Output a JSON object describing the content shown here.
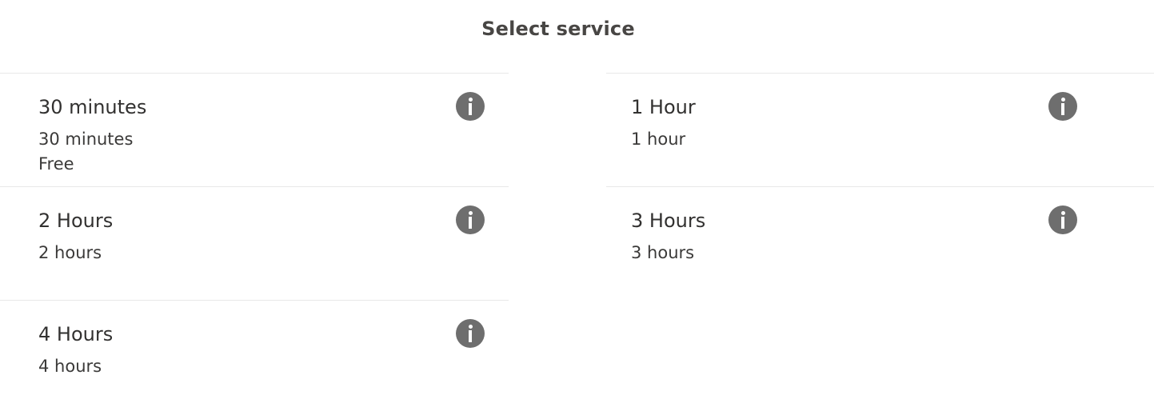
{
  "header": {
    "title": "Select service"
  },
  "services": [
    {
      "name": "30 minutes",
      "duration": "30 minutes",
      "price": "Free",
      "icon": "info-icon"
    },
    {
      "name": "1 Hour",
      "duration": "1 hour",
      "price": "",
      "icon": "info-icon"
    },
    {
      "name": "2 Hours",
      "duration": "2 hours",
      "price": "",
      "icon": "info-icon"
    },
    {
      "name": "3 Hours",
      "duration": "3 hours",
      "price": "",
      "icon": "info-icon"
    },
    {
      "name": "4 Hours",
      "duration": "4 hours",
      "price": "",
      "icon": "info-icon"
    }
  ],
  "colors": {
    "icon_background": "#6e6e6e",
    "divider": "#e8e8e8",
    "text": "#323130"
  }
}
